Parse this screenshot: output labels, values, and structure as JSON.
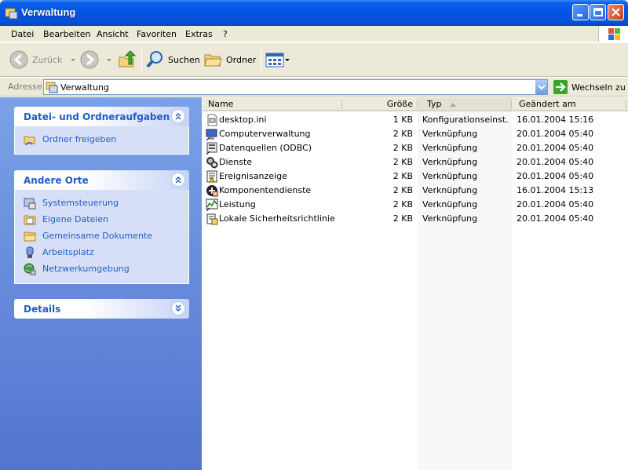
{
  "window": {
    "title": "Verwaltung"
  },
  "menu": [
    "Datei",
    "Bearbeiten",
    "Ansicht",
    "Favoriten",
    "Extras",
    "?"
  ],
  "toolbar": {
    "back_label": "Zurück",
    "search_label": "Suchen",
    "folders_label": "Ordner"
  },
  "address": {
    "label": "Adresse",
    "value": "Verwaltung",
    "go_label": "Wechseln zu"
  },
  "sidebar": {
    "file_tasks": {
      "title": "Datei- und Ordneraufgaben",
      "items": [
        {
          "label": "Ordner freigeben",
          "icon": "share-folder-icon"
        }
      ]
    },
    "other_places": {
      "title": "Andere Orte",
      "items": [
        {
          "label": "Systemsteuerung",
          "icon": "control-panel-icon"
        },
        {
          "label": "Eigene Dateien",
          "icon": "my-documents-icon"
        },
        {
          "label": "Gemeinsame Dokumente",
          "icon": "shared-documents-icon"
        },
        {
          "label": "Arbeitsplatz",
          "icon": "my-computer-icon"
        },
        {
          "label": "Netzwerkumgebung",
          "icon": "network-icon"
        }
      ]
    },
    "details": {
      "title": "Details"
    }
  },
  "columns": {
    "name": "Name",
    "size": "Größe",
    "type": "Typ",
    "modified": "Geändert am"
  },
  "files": [
    {
      "name": "desktop.ini",
      "size": "1 KB",
      "type": "Konfigurationseinst...",
      "modified": "16.01.2004 15:16",
      "icon": "ini-file-icon"
    },
    {
      "name": "Computerverwaltung",
      "size": "2 KB",
      "type": "Verknüpfung",
      "modified": "20.01.2004 05:40",
      "icon": "computer-management-icon"
    },
    {
      "name": "Datenquellen (ODBC)",
      "size": "2 KB",
      "type": "Verknüpfung",
      "modified": "20.01.2004 05:40",
      "icon": "odbc-icon"
    },
    {
      "name": "Dienste",
      "size": "2 KB",
      "type": "Verknüpfung",
      "modified": "20.01.2004 05:40",
      "icon": "services-icon"
    },
    {
      "name": "Ereignisanzeige",
      "size": "2 KB",
      "type": "Verknüpfung",
      "modified": "20.01.2004 05:40",
      "icon": "event-viewer-icon"
    },
    {
      "name": "Komponentendienste",
      "size": "2 KB",
      "type": "Verknüpfung",
      "modified": "16.01.2004 15:13",
      "icon": "component-services-icon"
    },
    {
      "name": "Leistung",
      "size": "2 KB",
      "type": "Verknüpfung",
      "modified": "20.01.2004 05:40",
      "icon": "performance-icon"
    },
    {
      "name": "Lokale Sicherheitsrichtlinie",
      "size": "2 KB",
      "type": "Verknüpfung",
      "modified": "20.01.2004 05:40",
      "icon": "security-policy-icon"
    }
  ],
  "colors": {
    "title_bar": "#0554e2",
    "sidebar": "#6a8fde",
    "link": "#215dc6",
    "chrome": "#ece9d8"
  }
}
